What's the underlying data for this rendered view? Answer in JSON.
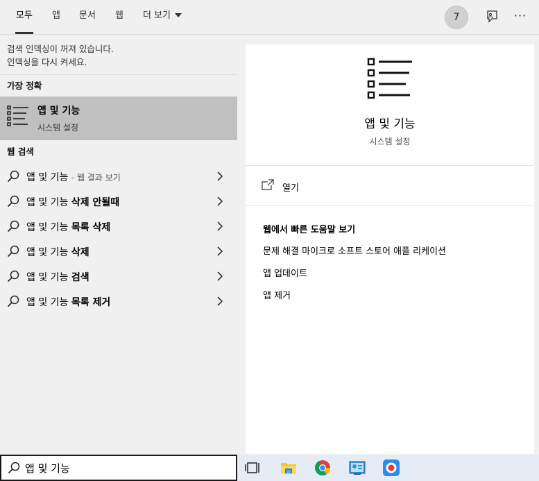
{
  "tabs": [
    {
      "label": "모두"
    },
    {
      "label": "앱"
    },
    {
      "label": "문서"
    },
    {
      "label": "웹"
    },
    {
      "label": "더 보기"
    }
  ],
  "badge_count": "7",
  "notice": {
    "line1": "검색 인덱싱이 꺼져 있습니다.",
    "line2": "인덱싱을 다시 켜세요."
  },
  "best_match": {
    "heading": "가장 정확",
    "title": "앱 및 기능",
    "subtitle": "시스템 설정"
  },
  "web": {
    "heading": "웹 검색",
    "results": [
      {
        "prefix": "앱 및 기능",
        "bold": "",
        "hint": "- 웹 결과 보기"
      },
      {
        "prefix": "앱 및 기능 ",
        "bold": "삭제 안될때",
        "hint": ""
      },
      {
        "prefix": "앱 및 기능 ",
        "bold": "목록 삭제",
        "hint": ""
      },
      {
        "prefix": "앱 및 기능 ",
        "bold": "삭제",
        "hint": ""
      },
      {
        "prefix": "앱 및 기능 ",
        "bold": "검색",
        "hint": ""
      },
      {
        "prefix": "앱 및 기능 ",
        "bold": "목록 제거",
        "hint": ""
      }
    ]
  },
  "preview": {
    "name": "앱 및 기능",
    "category": "시스템 설정",
    "open_label": "열기",
    "help_heading": "웹에서 빠른 도움말 보기",
    "help_links": [
      "문제 해결 마이크로 소프트 스토어 애플 리케이션",
      "앱 업데이트",
      "앱 제거"
    ]
  },
  "search": {
    "value": "앱 및 기능"
  },
  "taskbar_icons": [
    "task-view-icon",
    "file-explorer-icon",
    "chrome-icon",
    "control-panel-icon",
    "record-app-icon"
  ]
}
